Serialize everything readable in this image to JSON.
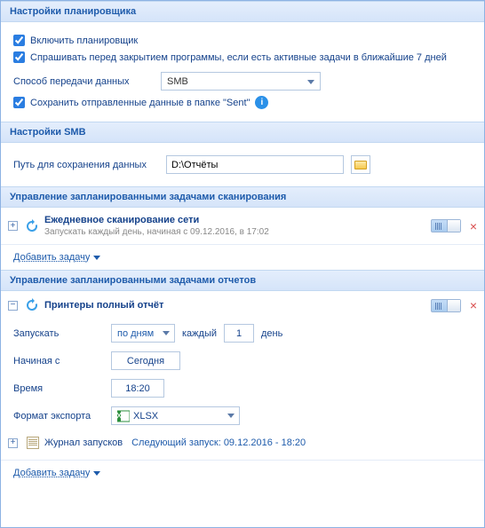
{
  "sections": {
    "scheduler": {
      "title": "Настройки планировщика"
    },
    "smb": {
      "title": "Настройки SMB"
    },
    "scan_tasks": {
      "title": "Управление запланированными задачами сканирования"
    },
    "report_tasks": {
      "title": "Управление запланированными задачами отчетов"
    }
  },
  "scheduler": {
    "enable": "Включить планировщик",
    "ask_before_close": "Спрашивать перед закрытием программы, если есть активные задачи в ближайшие 7 дней",
    "transfer_label": "Способ передачи данных",
    "transfer_value": "SMB",
    "save_sent": "Сохранить отправленные данные в папке \"Sent\""
  },
  "smb": {
    "path_label": "Путь для сохранения данных",
    "path_value": "D:\\Отчёты"
  },
  "scan_task": {
    "title": "Ежедневное сканирование сети",
    "subtitle": "Запускать каждый день, начиная с 09.12.2016, в 17:02"
  },
  "add_task": "Добавить задачу",
  "report_task": {
    "title": "Принтеры полный отчёт",
    "run_label": "Запускать",
    "interval_value": "по дням",
    "every_label": "каждый",
    "every_value": "1",
    "day_label": "день",
    "start_label": "Начиная с",
    "start_value": "Сегодня",
    "time_label": "Время",
    "time_value": "18:20",
    "export_label": "Формат экспорта",
    "export_value": "XLSX",
    "log_label": "Журнал запусков",
    "next_label": "Следующий запуск: 09.12.2016 - 18:20"
  }
}
